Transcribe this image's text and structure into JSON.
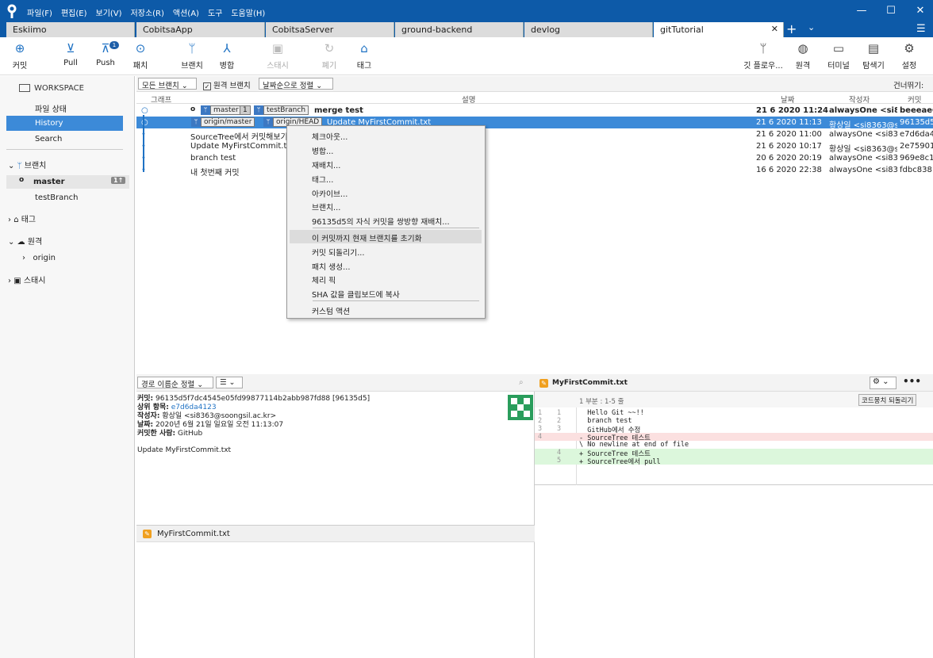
{
  "menu": [
    "파일(F)",
    "편집(E)",
    "보기(V)",
    "저장소(R)",
    "액션(A)",
    "도구",
    "도움말(H)"
  ],
  "window": {
    "minimize": "—",
    "maximize": "☐",
    "close": "✕"
  },
  "tabs": [
    "Eskiimo",
    "CobitsaApp",
    "CobitsaServer",
    "ground-backend",
    "devlog",
    "gitTutorial"
  ],
  "tabs_extra": {
    "close": "✕",
    "add": "+",
    "chev": "⌄",
    "hamburger": "☰"
  },
  "toolbar": {
    "commit": "커밋",
    "pull": "Pull",
    "push": "Push",
    "push_badge": "1",
    "fetch": "패치",
    "branch": "브랜치",
    "merge": "병합",
    "stash": "스태시",
    "discard": "폐기",
    "tag": "태그",
    "gitflow": "깃 플로우...",
    "remote": "원격",
    "terminal": "터미널",
    "explorer": "탐색기",
    "settings": "설정"
  },
  "sidebar": {
    "workspace": "WORKSPACE",
    "file_status": "파일 상태",
    "history": "History",
    "search": "Search",
    "branches": "브랜치",
    "master": "master",
    "master_badge": "1↑",
    "testBranch": "testBranch",
    "tags": "태그",
    "remotes": "원격",
    "origin": "origin",
    "stash": "스태시"
  },
  "filter": {
    "all_branches": "모든 브랜치 ⌄",
    "remote_branch": "원격 브랜치",
    "sort_date": "날짜순으로 정렬 ⌄",
    "skip": "건너뛰기:"
  },
  "columns": {
    "graph": "그래프",
    "desc": "설명",
    "date": "날짜",
    "author": "작성자",
    "commit": "커밋"
  },
  "commits": [
    {
      "desc": "merge test",
      "date": "21 6 2020 11:24",
      "author": "alwaysOne <si836",
      "hash": "beeeaeC",
      "tags": [
        "master",
        "1",
        "testBranch"
      ]
    },
    {
      "desc": "Update MyFirstCommit.txt",
      "date": "21 6 2020 11:13",
      "author": "황상일 <si8363@s",
      "hash": "96135d5",
      "tags": [
        "origin/master",
        "origin/HEAD"
      ]
    },
    {
      "desc": "SourceTree에서 커밋해보기",
      "date": "21 6 2020 11:00",
      "author": "alwaysOne <si836:",
      "hash": "e7d6da4"
    },
    {
      "desc": "Update MyFirstCommit.txt",
      "date": "21 6 2020 10:17",
      "author": "황상일 <si8363@s",
      "hash": "2e75901"
    },
    {
      "desc": "branch test",
      "date": "20 6 2020 20:19",
      "author": "alwaysOne <si836:",
      "hash": "969e8c1"
    },
    {
      "desc": "내 첫번째 커밋",
      "date": "16 6 2020 22:38",
      "author": "alwaysOne <si836:",
      "hash": "fdbc838"
    }
  ],
  "context_menu": [
    "체크아웃...",
    "병합...",
    "재배치...",
    "태그...",
    "아카이브...",
    "브랜치...",
    "96135d5의 자식 커밋을 쌍방향 재배치...",
    "이 커밋까지 현재 브랜치를 초기화",
    "커밋 되돌리기...",
    "패치 생성...",
    "체리 픽",
    "SHA 값을 클립보드에 복사",
    "커스텀 액션"
  ],
  "details": {
    "sort": "경로 이름순 정렬 ⌄",
    "view": "☰ ⌄",
    "commit_label": "커밋:",
    "commit_val": "96135d5f7dc4545e05fd99877114b2abb987fd88 [96135d5]",
    "parent_label": "상위 항목:",
    "parent_val": "e7d6da4123",
    "author_label": "작성자:",
    "author_val": "황상일 <si8363@soongsil.ac.kr>",
    "date_label": "날짜:",
    "date_val": "2020년 6월 21일 일요일 오전 11:13:07",
    "committer_label": "커밋한 사람:",
    "committer_val": "GitHub",
    "message": "Update MyFirstCommit.txt",
    "file": "MyFirstCommit.txt"
  },
  "diff": {
    "filename": "MyFirstCommit.txt",
    "hunk": "1 부분 : 1-5 줄",
    "revert": "코드뭉치 되돌리기",
    "lines": [
      {
        "o": "1",
        "n": "1",
        "t": "  Hello Git ~~!!",
        "k": "ctx"
      },
      {
        "o": "2",
        "n": "2",
        "t": "  branch test",
        "k": "ctx"
      },
      {
        "o": "3",
        "n": "3",
        "t": "  GitHub에서 수정",
        "k": "ctx"
      },
      {
        "o": "4",
        "n": "",
        "t": "- SourceTree 테스트",
        "k": "del"
      },
      {
        "o": "",
        "n": "",
        "t": "\\ No newline at end of file",
        "k": "ctx"
      },
      {
        "o": "",
        "n": "4",
        "t": "+ SourceTree 테스트",
        "k": "add"
      },
      {
        "o": "",
        "n": "5",
        "t": "+ SourceTree에서 pull",
        "k": "add"
      }
    ]
  },
  "colors": {
    "accent": "#0d5aa8",
    "selection": "#3c8ad8",
    "added": "#dcf7dc",
    "removed": "#fbe0e0"
  }
}
